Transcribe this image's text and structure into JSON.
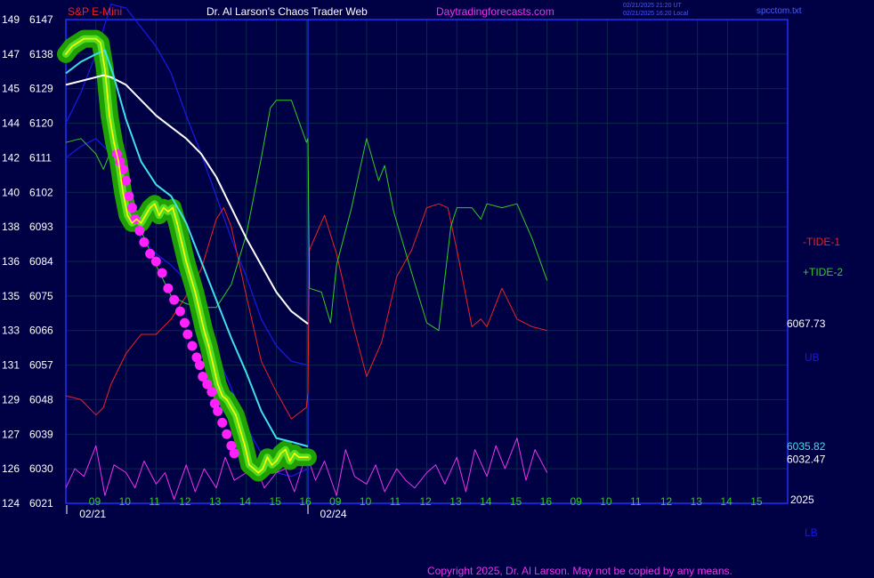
{
  "header": {
    "instrument": "S&P E-Mini",
    "title": "Dr. Al Larson's Chaos Trader Web",
    "site": "Daytradingforecasts.com",
    "stamp_line1": "02/21/2025 21:20 UT",
    "stamp_line2": "02/21/2025 16:20 Local",
    "file": "spcctom.txt"
  },
  "footer": {
    "copyright": "Copyright 2025, Dr. Al Larson. May not be copied by any means."
  },
  "colors": {
    "background": "#000044",
    "grid": "#0a2a4a",
    "frame": "#2030ff",
    "price": "#ffff00",
    "glow": "#22aa00",
    "dots": "#ff22ff",
    "white_ma": "#ffffff",
    "cyan_ma": "#40e0e8",
    "bands": "#1818e0",
    "tide1": "#ee2222",
    "tide2": "#33cc22",
    "cycle": "#ee33ee"
  },
  "chart_data": {
    "type": "line",
    "title": "S&P E-Mini",
    "y_axis": {
      "range": [
        6021,
        6147
      ],
      "ticks": [
        {
          "left": "149",
          "right": "6147",
          "value": 6147
        },
        {
          "left": "147",
          "right": "6138",
          "value": 6138
        },
        {
          "left": "145",
          "right": "6129",
          "value": 6129
        },
        {
          "left": "144",
          "right": "6120",
          "value": 6120
        },
        {
          "left": "142",
          "right": "6111",
          "value": 6111
        },
        {
          "left": "140",
          "right": "6102",
          "value": 6102
        },
        {
          "left": "138",
          "right": "6093",
          "value": 6093
        },
        {
          "left": "136",
          "right": "6084",
          "value": 6084
        },
        {
          "left": "135",
          "right": "6075",
          "value": 6075
        },
        {
          "left": "133",
          "right": "6066",
          "value": 6066
        },
        {
          "left": "131",
          "right": "6057",
          "value": 6057
        },
        {
          "left": "129",
          "right": "6048",
          "value": 6048
        },
        {
          "left": "127",
          "right": "6039",
          "value": 6039
        },
        {
          "left": "126",
          "right": "6030",
          "value": 6030
        },
        {
          "left": "124",
          "right": "6021",
          "value": 6021
        }
      ]
    },
    "x_axis": {
      "range": [
        8.0,
        32.0
      ],
      "ticks": [
        {
          "label": "09",
          "x": 9
        },
        {
          "label": "10",
          "x": 10
        },
        {
          "label": "11",
          "x": 11
        },
        {
          "label": "12",
          "x": 12
        },
        {
          "label": "13",
          "x": 13
        },
        {
          "label": "14",
          "x": 14
        },
        {
          "label": "15",
          "x": 15
        },
        {
          "label": "16",
          "x": 16
        },
        {
          "label": "09",
          "x": 17
        },
        {
          "label": "10",
          "x": 18
        },
        {
          "label": "11",
          "x": 19
        },
        {
          "label": "12",
          "x": 20
        },
        {
          "label": "13",
          "x": 21
        },
        {
          "label": "14",
          "x": 22
        },
        {
          "label": "15",
          "x": 23
        },
        {
          "label": "16",
          "x": 24
        },
        {
          "label": "09",
          "x": 25
        },
        {
          "label": "10",
          "x": 26
        },
        {
          "label": "11",
          "x": 27
        },
        {
          "label": "12",
          "x": 28
        },
        {
          "label": "13",
          "x": 29
        },
        {
          "label": "14",
          "x": 30
        },
        {
          "label": "15",
          "x": 31
        }
      ],
      "dates": [
        {
          "label": "02/21",
          "x": 8.45
        },
        {
          "label": "02/24",
          "x": 16.45
        }
      ],
      "session_break": 16.05,
      "extra_label": "2025"
    },
    "grid": true,
    "legend": [
      {
        "name": "-TIDE-1",
        "color": "#ee2222"
      },
      {
        "name": "+TIDE-2",
        "color": "#33cc22"
      },
      {
        "name": "UB",
        "color": "#1818e0"
      },
      {
        "name": "LB",
        "color": "#1818e0"
      }
    ],
    "right_values": [
      {
        "label": "6067.73",
        "value": 6067.73,
        "color": "#ffffff"
      },
      {
        "label": "6035.82",
        "value": 6035.82,
        "color": "#40e0e8"
      },
      {
        "label": "6032.47",
        "value": 6032.47,
        "color": "#ffffff"
      }
    ],
    "series": [
      {
        "name": "price",
        "role": "price",
        "x": [
          8.0,
          8.2,
          8.4,
          8.6,
          8.8,
          9.0,
          9.15,
          9.3,
          9.45,
          9.6,
          9.75,
          9.9,
          10.05,
          10.2,
          10.35,
          10.5,
          10.65,
          10.8,
          10.95,
          11.1,
          11.25,
          11.4,
          11.55,
          11.7,
          11.85,
          12.0,
          12.15,
          12.3,
          12.45,
          12.6,
          12.75,
          12.9,
          13.05,
          13.2,
          13.35,
          13.5,
          13.65,
          13.8,
          13.95,
          14.1,
          14.25,
          14.4,
          14.55,
          14.7,
          14.85,
          15.0,
          15.15,
          15.3,
          15.45,
          15.6,
          15.75,
          15.9,
          16.05
        ],
        "values": [
          6138,
          6140,
          6141,
          6142,
          6142,
          6142,
          6141,
          6134,
          6122,
          6115,
          6110,
          6102,
          6096,
          6094,
          6095,
          6094,
          6096,
          6098,
          6099,
          6096,
          6098,
          6097,
          6098,
          6094,
          6089,
          6084,
          6080,
          6076,
          6071,
          6066,
          6062,
          6057,
          6052,
          6049,
          6048,
          6046,
          6044,
          6040,
          6036,
          6031,
          6030,
          6029,
          6030,
          6033,
          6031,
          6032,
          6034,
          6035,
          6032,
          6034,
          6033,
          6033,
          6033
        ]
      },
      {
        "name": "white average",
        "role": "white_ma",
        "x": [
          8.0,
          8.5,
          9.0,
          9.25,
          9.5,
          10.0,
          10.5,
          11.0,
          11.5,
          12.0,
          12.5,
          13.0,
          13.5,
          14.0,
          14.5,
          15.0,
          15.5,
          16.05
        ],
        "values": [
          6130,
          6131,
          6132,
          6132.5,
          6132,
          6130,
          6126,
          6122,
          6119,
          6116,
          6112,
          6106,
          6098,
          6090,
          6083,
          6076,
          6071,
          6067.73
        ]
      },
      {
        "name": "cyan average",
        "role": "cyan_ma",
        "x": [
          8.0,
          8.5,
          9.0,
          9.3,
          9.6,
          10.0,
          10.5,
          11.0,
          11.5,
          12.0,
          12.5,
          13.0,
          13.5,
          14.0,
          14.5,
          15.0,
          15.5,
          16.05
        ],
        "values": [
          6133,
          6136,
          6138,
          6139,
          6132,
          6121,
          6110,
          6104,
          6101,
          6094,
          6084,
          6074,
          6064,
          6055,
          6045,
          6038,
          6037,
          6035.82
        ]
      },
      {
        "name": "UB",
        "role": "band",
        "x": [
          8.0,
          8.5,
          9.0,
          9.5,
          10.0,
          10.5,
          11.0,
          11.5,
          12.0,
          12.5,
          13.0,
          13.5,
          14.0,
          14.5,
          15.0,
          15.5,
          16.05
        ],
        "values": [
          6120,
          6128,
          6138,
          6151,
          6150,
          6145,
          6140,
          6133,
          6122,
          6112,
          6101,
          6090,
          6080,
          6069,
          6062,
          6058,
          6057
        ]
      },
      {
        "name": "LB",
        "role": "band",
        "x": [
          8.0,
          8.5,
          9.0,
          9.5,
          10.0,
          10.5,
          11.0,
          11.5,
          12.0,
          12.5,
          13.0,
          13.5,
          14.0,
          14.5,
          15.0,
          15.5,
          16.05
        ],
        "values": [
          6111,
          6114,
          6116,
          6112,
          6100,
          6090,
          6086,
          6083,
          6079,
          6070,
          6060,
          6051,
          6041,
          6034,
          6029,
          6028,
          6030
        ]
      },
      {
        "name": "-TIDE-1",
        "role": "tide1",
        "x": [
          8.0,
          8.5,
          9.0,
          9.25,
          9.5,
          10.0,
          10.5,
          11.0,
          11.5,
          12.0,
          12.5,
          13.0,
          13.25,
          13.5,
          14.0,
          14.5,
          15.0,
          15.5,
          16.0,
          16.05,
          16.1,
          16.6,
          17.0,
          17.5,
          18.0,
          18.5,
          19.0,
          19.5,
          20.0,
          20.4,
          20.7,
          21.0,
          21.5,
          21.8,
          22.0,
          22.5,
          23.0,
          23.5,
          24.0
        ],
        "values": [
          6049,
          6048,
          6044,
          6046,
          6052,
          6060,
          6065,
          6065,
          6069,
          6075,
          6082,
          6095,
          6098,
          6093,
          6075,
          6058,
          6050,
          6043,
          6046,
          6050,
          6087,
          6096,
          6086,
          6069,
          6054,
          6063,
          6080,
          6087,
          6098,
          6099,
          6098,
          6087,
          6067,
          6069,
          6067,
          6077,
          6069,
          6067,
          6066
        ]
      },
      {
        "name": "+TIDE-2",
        "role": "tide2",
        "x": [
          8.0,
          8.5,
          9.0,
          9.25,
          9.5,
          10.0,
          10.5,
          11.0,
          11.5,
          12.0,
          12.5,
          13.0,
          13.5,
          14.0,
          14.5,
          14.8,
          15.0,
          15.5,
          16.0,
          16.05,
          16.1,
          16.5,
          16.8,
          17.0,
          17.5,
          18.0,
          18.4,
          18.6,
          18.9,
          19.5,
          20.0,
          20.4,
          20.8,
          21.0,
          21.5,
          21.8,
          22.0,
          22.5,
          23.0,
          23.5,
          24.0
        ],
        "values": [
          6115,
          6116,
          6112,
          6108,
          6113,
          6108,
          6092,
          6083,
          6075,
          6073,
          6072,
          6072,
          6078,
          6091,
          6111,
          6124,
          6126,
          6126,
          6115,
          6116,
          6077,
          6076,
          6068,
          6083,
          6098,
          6116,
          6105,
          6109,
          6097,
          6081,
          6068,
          6066,
          6093,
          6098,
          6098,
          6095,
          6099,
          6098,
          6099,
          6090,
          6079
        ]
      },
      {
        "name": "cycle",
        "role": "cycle",
        "x": [
          8.0,
          8.3,
          8.6,
          9.0,
          9.3,
          9.6,
          10.0,
          10.3,
          10.6,
          11.0,
          11.3,
          11.6,
          12.0,
          12.3,
          12.6,
          13.0,
          13.3,
          13.6,
          14.0,
          14.3,
          14.6,
          15.0,
          15.3,
          15.6,
          16.0,
          16.3,
          16.6,
          17.0,
          17.3,
          17.6,
          18.0,
          18.3,
          18.6,
          19.0,
          19.3,
          19.6,
          20.0,
          20.3,
          20.6,
          21.0,
          21.3,
          21.6,
          22.0,
          22.3,
          22.6,
          23.0,
          23.3,
          23.6,
          24.0
        ],
        "values": [
          6025,
          6030,
          6028,
          6036,
          6023,
          6031,
          6029,
          6025,
          6032,
          6026,
          6029,
          6022,
          6031,
          6024,
          6030,
          6025,
          6033,
          6027,
          6029,
          6031,
          6025,
          6029,
          6030,
          6024,
          6034,
          6027,
          6032,
          6023,
          6035,
          6028,
          6026,
          6031,
          6024,
          6030,
          6027,
          6025,
          6029,
          6031,
          6026,
          6033,
          6024,
          6035,
          6028,
          6036,
          6030,
          6038,
          6027,
          6035,
          6029
        ]
      },
      {
        "name": "forecast dots",
        "role": "dots",
        "x": [
          9.7,
          9.8,
          9.9,
          10.0,
          10.1,
          10.2,
          10.3,
          10.45,
          10.6,
          10.8,
          11.0,
          11.2,
          11.4,
          11.6,
          11.8,
          11.95,
          12.05,
          12.2,
          12.35,
          12.45,
          12.55,
          12.7,
          12.85,
          12.95,
          13.05,
          13.2,
          13.35,
          13.5,
          13.6
        ],
        "values": [
          6112,
          6110,
          6108,
          6105,
          6101,
          6098,
          6095,
          6092,
          6089,
          6086,
          6084,
          6081,
          6077,
          6074,
          6071,
          6068,
          6065,
          6062,
          6059,
          6057,
          6054,
          6052,
          6050,
          6047,
          6045,
          6042,
          6039,
          6036,
          6034
        ]
      }
    ]
  }
}
